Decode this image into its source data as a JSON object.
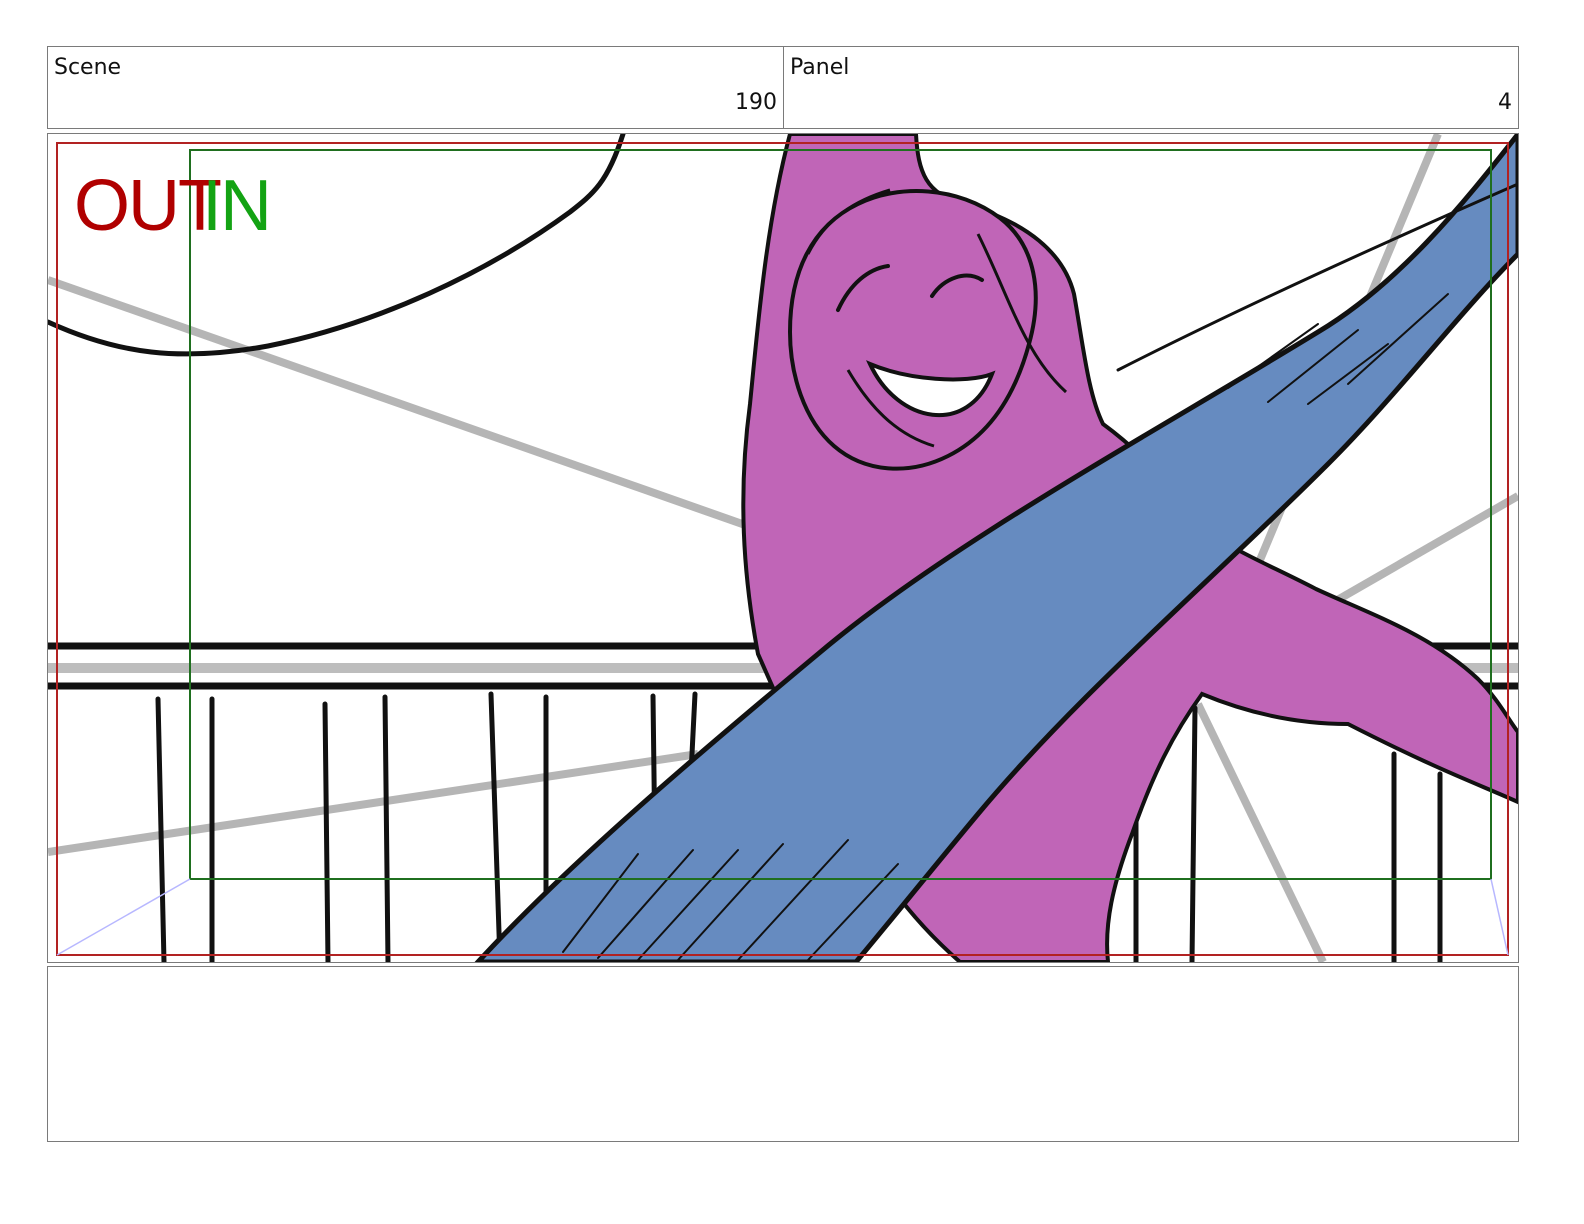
{
  "header": {
    "scene_label": "Scene",
    "scene_value": "190",
    "panel_label": "Panel",
    "panel_value": "4"
  },
  "frame": {
    "out_text": "OUT",
    "in_text": "IN",
    "out_color": "#b00000",
    "in_color": "#13a313",
    "safe_out_color": "#b22222",
    "safe_in_color": "#1f6f1f",
    "character_color": "#c065b7",
    "ribbon_color": "#668bc0",
    "perspective_line_color": "#b0b0b0"
  },
  "notes": {
    "text": ""
  }
}
